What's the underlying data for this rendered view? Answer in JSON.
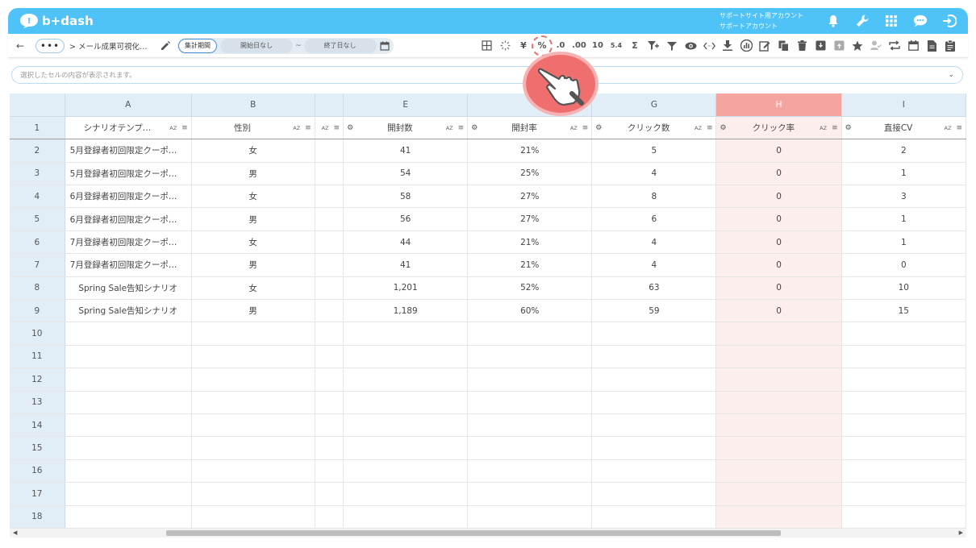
{
  "header": {
    "logo_text": "b+dash",
    "account_line1": "サポートサイト用アカウント",
    "account_line2": "サポートアカウント",
    "icons": [
      "bell-icon",
      "wrench-icon",
      "apps-grid-icon",
      "chat-bubble-icon",
      "logout-icon"
    ]
  },
  "toolbar": {
    "back": "←",
    "more": "•••",
    "breadcrumb": "> メール成果可視化…",
    "period_label": "集計期間",
    "start_date": "開始日なし",
    "tilde": "~",
    "end_date": "終了日なし",
    "tools": {
      "yen": "¥",
      "percent": "%",
      "dec_dec": ".0",
      "inc_dec": ".00",
      "ten": "10",
      "five_four": "5.4",
      "sigma": "Σ"
    }
  },
  "formula_bar": {
    "placeholder": "選択したセルの内容が表示されます。"
  },
  "grid": {
    "columns": [
      {
        "letter": "A",
        "field": "シナリオテンプ…"
      },
      {
        "letter": "B",
        "field": "性別"
      },
      {
        "letter": "",
        "field": ""
      },
      {
        "letter": "E",
        "field": "開封数"
      },
      {
        "letter": "",
        "field": "開封率"
      },
      {
        "letter": "G",
        "field": "クリック数"
      },
      {
        "letter": "H",
        "field": "クリック率"
      },
      {
        "letter": "I",
        "field": "直接CV"
      }
    ],
    "az": "AZ",
    "row_numbers": [
      "1",
      "2",
      "3",
      "4",
      "5",
      "6",
      "7",
      "8",
      "9",
      "10",
      "11",
      "12",
      "13",
      "14",
      "15",
      "16",
      "17",
      "18"
    ],
    "rows": [
      [
        "5月登録者初回限定クーポ…",
        "女",
        "",
        "41",
        "21%",
        "5",
        "0",
        "2"
      ],
      [
        "5月登録者初回限定クーポ…",
        "男",
        "",
        "54",
        "25%",
        "4",
        "0",
        "1"
      ],
      [
        "6月登録者初回限定クーポ…",
        "女",
        "",
        "58",
        "27%",
        "8",
        "0",
        "3"
      ],
      [
        "6月登録者初回限定クーポ…",
        "男",
        "",
        "56",
        "27%",
        "6",
        "0",
        "1"
      ],
      [
        "7月登録者初回限定クーポ…",
        "女",
        "",
        "44",
        "21%",
        "4",
        "0",
        "1"
      ],
      [
        "7月登録者初回限定クーポ…",
        "男",
        "",
        "41",
        "21%",
        "4",
        "0",
        "0"
      ],
      [
        "Spring Sale告知シナリオ",
        "女",
        "",
        "1,201",
        "52%",
        "63",
        "0",
        "10"
      ],
      [
        "Spring Sale告知シナリオ",
        "男",
        "",
        "1,189",
        "60%",
        "59",
        "0",
        "15"
      ]
    ]
  },
  "colors": {
    "brand": "#4fc3f7",
    "highlight_header": "#f5a5a0",
    "highlight_column": "#fdeeee",
    "hand": "#ef6f6f"
  }
}
